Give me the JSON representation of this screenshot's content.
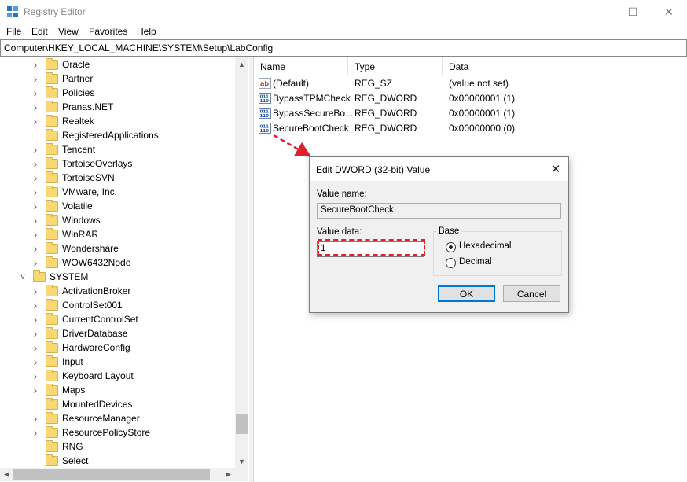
{
  "window": {
    "title": "Registry Editor",
    "minimize_glyph": "—",
    "maximize_glyph": "☐",
    "close_glyph": "✕"
  },
  "menu": {
    "items": [
      "File",
      "Edit",
      "View",
      "Favorites",
      "Help"
    ]
  },
  "address": {
    "path": "Computer\\HKEY_LOCAL_MACHINE\\SYSTEM\\Setup\\LabConfig"
  },
  "tree": {
    "items": [
      {
        "label": "Oracle",
        "level": 2,
        "expandable": true
      },
      {
        "label": "Partner",
        "level": 2,
        "expandable": true
      },
      {
        "label": "Policies",
        "level": 2,
        "expandable": true
      },
      {
        "label": "Pranas.NET",
        "level": 2,
        "expandable": true
      },
      {
        "label": "Realtek",
        "level": 2,
        "expandable": true
      },
      {
        "label": "RegisteredApplications",
        "level": 2,
        "expandable": false
      },
      {
        "label": "Tencent",
        "level": 2,
        "expandable": true
      },
      {
        "label": "TortoiseOverlays",
        "level": 2,
        "expandable": true
      },
      {
        "label": "TortoiseSVN",
        "level": 2,
        "expandable": true
      },
      {
        "label": "VMware, Inc.",
        "level": 2,
        "expandable": true
      },
      {
        "label": "Volatile",
        "level": 2,
        "expandable": true
      },
      {
        "label": "Windows",
        "level": 2,
        "expandable": true
      },
      {
        "label": "WinRAR",
        "level": 2,
        "expandable": true
      },
      {
        "label": "Wondershare",
        "level": 2,
        "expandable": true
      },
      {
        "label": "WOW6432Node",
        "level": 2,
        "expandable": true
      },
      {
        "label": "SYSTEM",
        "level": 1,
        "expandable": true,
        "expanded": true
      },
      {
        "label": "ActivationBroker",
        "level": 2,
        "expandable": true
      },
      {
        "label": "ControlSet001",
        "level": 2,
        "expandable": true
      },
      {
        "label": "CurrentControlSet",
        "level": 2,
        "expandable": true
      },
      {
        "label": "DriverDatabase",
        "level": 2,
        "expandable": true
      },
      {
        "label": "HardwareConfig",
        "level": 2,
        "expandable": true
      },
      {
        "label": "Input",
        "level": 2,
        "expandable": true
      },
      {
        "label": "Keyboard Layout",
        "level": 2,
        "expandable": true
      },
      {
        "label": "Maps",
        "level": 2,
        "expandable": true
      },
      {
        "label": "MountedDevices",
        "level": 2,
        "expandable": false
      },
      {
        "label": "ResourceManager",
        "level": 2,
        "expandable": true
      },
      {
        "label": "ResourcePolicyStore",
        "level": 2,
        "expandable": true
      },
      {
        "label": "RNG",
        "level": 2,
        "expandable": false
      },
      {
        "label": "Select",
        "level": 2,
        "expandable": false
      }
    ]
  },
  "values_list": {
    "headers": {
      "name": "Name",
      "type": "Type",
      "data": "Data"
    },
    "rows": [
      {
        "name": "(Default)",
        "type": "REG_SZ",
        "data": "(value not set)",
        "icon": "string-value-icon"
      },
      {
        "name": "BypassTPMCheck",
        "type": "REG_DWORD",
        "data": "0x00000001 (1)",
        "icon": "binary-value-icon"
      },
      {
        "name": "BypassSecureBo...",
        "type": "REG_DWORD",
        "data": "0x00000001 (1)",
        "icon": "binary-value-icon"
      },
      {
        "name": "SecureBootCheck",
        "type": "REG_DWORD",
        "data": "0x00000000 (0)",
        "icon": "binary-value-icon"
      }
    ]
  },
  "dialog": {
    "title": "Edit DWORD (32-bit) Value",
    "value_name_label": "Value name:",
    "value_name": "SecureBootCheck",
    "value_data_label": "Value data:",
    "value_data": "1",
    "base_label": "Base",
    "radio_hex": "Hexadecimal",
    "radio_dec": "Decimal",
    "selected_base": "Hexadecimal",
    "ok_label": "OK",
    "cancel_label": "Cancel"
  },
  "colors": {
    "annotation": "#e0202a",
    "focus_border": "#0078d7",
    "folder": "#f8d775"
  }
}
